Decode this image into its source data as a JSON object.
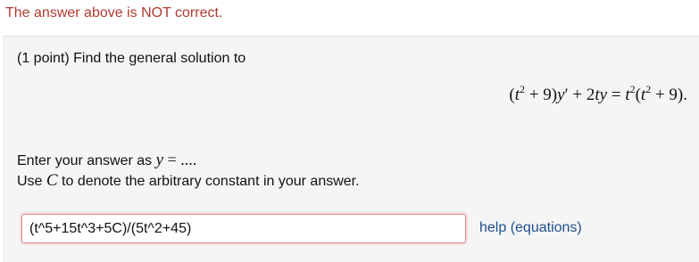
{
  "status_message": "The answer above is NOT correct.",
  "problem": {
    "prompt": "(1 point) Find the general solution to",
    "equation": {
      "lhs_open": "(",
      "t1": "t",
      "exp1": "2",
      "plus9a": " + 9)",
      "y_prime": "y",
      "prime": "′",
      "plus": " + ",
      "two": "2",
      "t2": "t",
      "y2": "y",
      "equals": " = ",
      "t3": "t",
      "exp2": "2",
      "rhs_open": "(",
      "t4": "t",
      "exp3": "2",
      "plus9b": " + 9)."
    },
    "instruction_prefix": "Enter your answer as ",
    "instruction_var": "y",
    "instruction_rel": " = ",
    "instruction_dots": "....",
    "constant_prefix": "Use ",
    "constant_var": "C",
    "constant_suffix": " to denote the arbitrary constant in your answer."
  },
  "answer": {
    "value": "(t^5+15t^3+5C)/(5t^2+45)",
    "status": "incorrect",
    "border_color": "#e08a8a"
  },
  "help_link": "help (equations)",
  "colors": {
    "status_text": "#b03a2e",
    "panel_bg": "#f5f5f5",
    "link": "#1f4f8c"
  }
}
